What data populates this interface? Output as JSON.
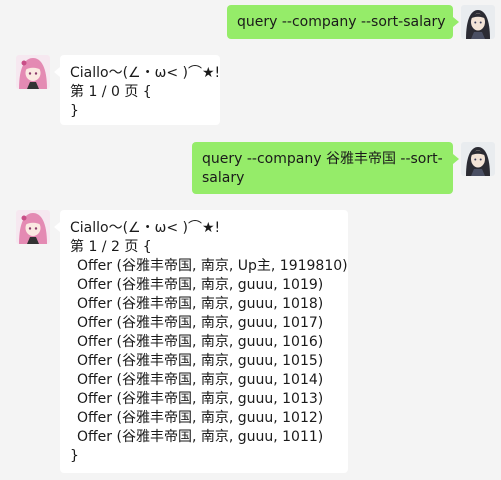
{
  "messages": {
    "m1": {
      "text": "query --company --sort-salary"
    },
    "m2": {
      "lines": [
        "Ciallo～(∠・ω< )⌒★!",
        "第 1 / 0 页 {",
        "}"
      ]
    },
    "m3": {
      "lines": [
        "query --company 谷雅丰帝国 --sort-",
        "salary"
      ]
    },
    "m4": {
      "header": [
        "Ciallo～(∠・ω< )⌒★!",
        "第 1 / 2 页 {"
      ],
      "offers": [
        "Offer (谷雅丰帝国, 南京, Up主, 1919810)",
        "Offer (谷雅丰帝国, 南京, guuu, 1019)",
        "Offer (谷雅丰帝国, 南京, guuu, 1018)",
        "Offer (谷雅丰帝国, 南京, guuu, 1017)",
        "Offer (谷雅丰帝国, 南京, guuu, 1016)",
        "Offer (谷雅丰帝国, 南京, guuu, 1015)",
        "Offer (谷雅丰帝国, 南京, guuu, 1014)",
        "Offer (谷雅丰帝国, 南京, guuu, 1013)",
        "Offer (谷雅丰帝国, 南京, guuu, 1012)",
        "Offer (谷雅丰帝国, 南京, guuu, 1011)"
      ],
      "footer": "}"
    }
  },
  "colors": {
    "background": "#f4f4f4",
    "outgoing_bubble": "#95ec69",
    "incoming_bubble": "#ffffff"
  },
  "avatars": {
    "user": "dark-hair-user-avatar-icon",
    "bot": "pink-hair-bot-avatar-icon"
  }
}
